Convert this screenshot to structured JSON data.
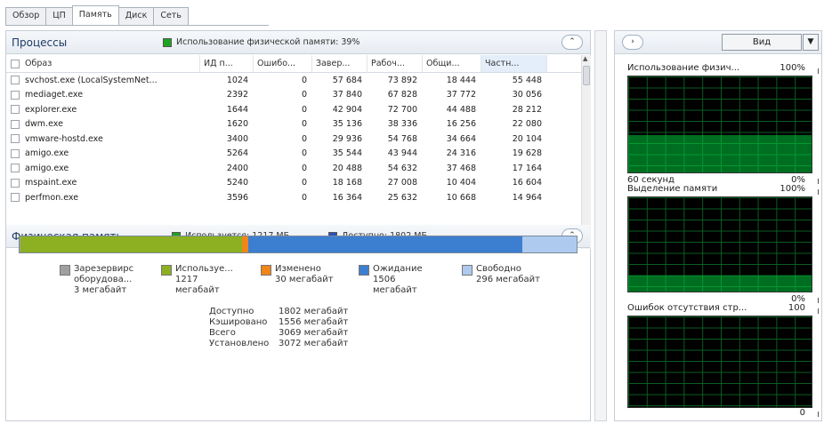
{
  "tabs": [
    "Обзор",
    "ЦП",
    "Память",
    "Диск",
    "Сеть"
  ],
  "processes": {
    "title": "Процессы",
    "usage_note": "Использование физической памяти: 39%",
    "columns": [
      "Образ",
      "ИД п...",
      "Ошибо...",
      "Завер...",
      "Рабоч...",
      "Общи...",
      "Частн..."
    ],
    "rows": [
      [
        "svchost.exe (LocalSystemNet...",
        "1024",
        "0",
        "57 684",
        "73 892",
        "18 444",
        "55 448"
      ],
      [
        "mediaget.exe",
        "2392",
        "0",
        "37 840",
        "67 828",
        "37 772",
        "30 056"
      ],
      [
        "explorer.exe",
        "1644",
        "0",
        "42 904",
        "72 700",
        "44 488",
        "28 212"
      ],
      [
        "dwm.exe",
        "1620",
        "0",
        "35 136",
        "38 336",
        "16 256",
        "22 080"
      ],
      [
        "vmware-hostd.exe",
        "3400",
        "0",
        "29 936",
        "54 768",
        "34 664",
        "20 104"
      ],
      [
        "amigo.exe",
        "5264",
        "0",
        "35 544",
        "43 944",
        "24 316",
        "19 628"
      ],
      [
        "amigo.exe",
        "2400",
        "0",
        "20 488",
        "54 632",
        "37 468",
        "17 164"
      ],
      [
        "mspaint.exe",
        "5240",
        "0",
        "18 168",
        "27 008",
        "10 404",
        "16 604"
      ],
      [
        "perfmon.exe",
        "3596",
        "0",
        "16 364",
        "25 632",
        "10 668",
        "14 964"
      ]
    ]
  },
  "physical": {
    "title": "Физическая память",
    "used_note": "Используется: 1217 МБ",
    "available_note": "Доступно: 1802 МБ",
    "bar": [
      {
        "name": "Зарезервировано оборудованием",
        "mb": 3,
        "color": "#a0a0a0"
      },
      {
        "name": "Используется",
        "mb": 1217,
        "color": "#8cb021"
      },
      {
        "name": "Изменено",
        "mb": 30,
        "color": "#f08519"
      },
      {
        "name": "Ожидание",
        "mb": 1506,
        "color": "#3c7fd1"
      },
      {
        "name": "Свободно",
        "mb": 296,
        "color": "#aecaee"
      }
    ],
    "legend": [
      {
        "l1": "Зарезервирс",
        "l2": "оборудова...",
        "l3": "3 мегабайт",
        "color": "#a0a0a0"
      },
      {
        "l1": "Используе...",
        "l2": "1217",
        "l3": "мегабайт",
        "color": "#8cb021"
      },
      {
        "l1": "Изменено",
        "l2": "30 мегабайт",
        "l3": "",
        "color": "#f08519"
      },
      {
        "l1": "Ожидание",
        "l2": "1506",
        "l3": "мегабайт",
        "color": "#3c7fd1"
      },
      {
        "l1": "Свободно",
        "l2": "296 мегабайт",
        "l3": "",
        "color": "#aecaee"
      }
    ],
    "stats": [
      [
        "Доступно",
        "1802 мегабайт"
      ],
      [
        "Кэшировано",
        "1556 мегабайт"
      ],
      [
        "Всего",
        "3069 мегабайт"
      ],
      [
        "Установлено",
        "3072 мегабайт"
      ]
    ]
  },
  "right": {
    "view_label": "Вид",
    "graphs": [
      {
        "title": "Использование физич...",
        "max": "100%",
        "foot_left": "60 секунд",
        "foot_right": "0%",
        "fill_fraction": 0.39
      },
      {
        "title": "Выделение памяти",
        "max": "100%",
        "foot_left": "",
        "foot_right": "0%",
        "fill_fraction": 0.17
      },
      {
        "title": "Ошибок отсутствия стр...",
        "max": "100",
        "foot_left": "",
        "foot_right": "0",
        "fill_fraction": 0.0
      }
    ]
  }
}
